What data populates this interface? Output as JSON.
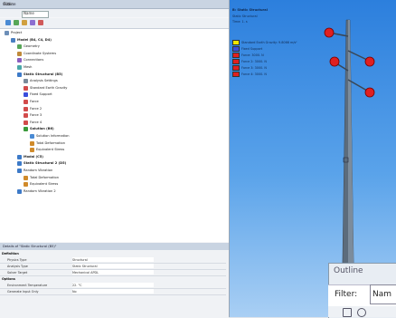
{
  "outline": {
    "title": "Outline",
    "filter_label": "Filter:",
    "filter_value": "Name"
  },
  "tree": {
    "items": [
      {
        "label": "Project",
        "depth": 0,
        "icon": "project"
      },
      {
        "label": "Model (B4, C4, D4)",
        "depth": 1,
        "icon": "model",
        "bold": true
      },
      {
        "label": "Geometry",
        "depth": 2,
        "icon": "geometry"
      },
      {
        "label": "Coordinate Systems",
        "depth": 2,
        "icon": "coord"
      },
      {
        "label": "Connections",
        "depth": 2,
        "icon": "connection"
      },
      {
        "label": "Mesh",
        "depth": 2,
        "icon": "mesh"
      },
      {
        "label": "Static Structural (B5)",
        "depth": 2,
        "icon": "analysis",
        "bold": true
      },
      {
        "label": "Analysis Settings",
        "depth": 3,
        "icon": "settings"
      },
      {
        "label": "Standard Earth Gravity",
        "depth": 3,
        "icon": "load"
      },
      {
        "label": "Fixed Support",
        "depth": 3,
        "icon": "support"
      },
      {
        "label": "Force",
        "depth": 3,
        "icon": "load"
      },
      {
        "label": "Force 2",
        "depth": 3,
        "icon": "load"
      },
      {
        "label": "Force 3",
        "depth": 3,
        "icon": "load"
      },
      {
        "label": "Force 4",
        "depth": 3,
        "icon": "load"
      },
      {
        "label": "Solution (B6)",
        "depth": 3,
        "icon": "solution",
        "bold": true
      },
      {
        "label": "Solution Information",
        "depth": 4,
        "icon": "info"
      },
      {
        "label": "Total Deformation",
        "depth": 4,
        "icon": "result"
      },
      {
        "label": "Equivalent Stress",
        "depth": 4,
        "icon": "result"
      },
      {
        "label": "Modal (C5)",
        "depth": 2,
        "icon": "analysis",
        "bold": true
      },
      {
        "label": "Static Structural 2 (D5)",
        "depth": 2,
        "icon": "analysis",
        "bold": true
      },
      {
        "label": "Random Vibration",
        "depth": 2,
        "icon": "analysis"
      },
      {
        "label": "Total Deformation",
        "depth": 3,
        "icon": "result"
      },
      {
        "label": "Equivalent Stress",
        "depth": 3,
        "icon": "result"
      },
      {
        "label": "Random Vibration 2",
        "depth": 2,
        "icon": "analysis"
      }
    ]
  },
  "details": {
    "title": "Details of \"Static Structural (B5)\"",
    "groups": [
      {
        "name": "Definition",
        "rows": [
          {
            "key": "Physics Type",
            "value": "Structural"
          },
          {
            "key": "Analysis Type",
            "value": "Static Structural"
          },
          {
            "key": "Solver Target",
            "value": "Mechanical APDL"
          }
        ]
      },
      {
        "name": "Options",
        "rows": [
          {
            "key": "Environment Temperature",
            "value": "22. °C"
          },
          {
            "key": "Generate Input Only",
            "value": "No"
          }
        ]
      }
    ]
  },
  "viewport": {
    "title": "B: Static Structural",
    "subtitle": "Static Structural",
    "time": "Time: 1. s",
    "date": "",
    "legend": [
      {
        "label": "Standard Earth Gravity: 9.8066 m/s²",
        "color": "#f2e600"
      },
      {
        "label": "Fixed Support",
        "color": "#3a4ddc"
      },
      {
        "label": "Force: 3000. N",
        "color": "#e02020"
      },
      {
        "label": "Force 2: 3000. N",
        "color": "#e02020"
      },
      {
        "label": "Force 3: 3000. N",
        "color": "#e02020"
      },
      {
        "label": "Force 4: 3000. N",
        "color": "#e02020"
      }
    ]
  },
  "float_panel": {
    "title": "Outline",
    "filter_label": "Filter:",
    "filter_value": "Nam"
  }
}
